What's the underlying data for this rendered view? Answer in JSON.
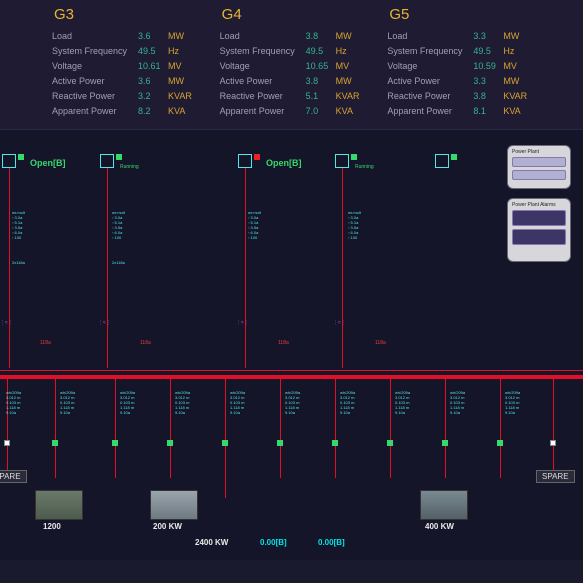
{
  "metrics_labels": [
    "Load",
    "System Frequency",
    "Voltage",
    "Active Power",
    "Reactive Power",
    "Apparent Power"
  ],
  "units": [
    "MW",
    "Hz",
    "MV",
    "MW",
    "KVAR",
    "KVA"
  ],
  "generators": [
    {
      "name": "G3",
      "values": [
        "3.6",
        "49.5",
        "10.61",
        "3.6",
        "3.2",
        "8.2"
      ]
    },
    {
      "name": "G4",
      "values": [
        "3.8",
        "49.5",
        "10.65",
        "3.8",
        "5.1",
        "7.0"
      ]
    },
    {
      "name": "G5",
      "values": [
        "3.3",
        "49.5",
        "10.59",
        "3.3",
        "3.8",
        "8.1"
      ]
    }
  ],
  "open_label": "Open[B]",
  "power_plant": "Power Plant",
  "power_plant_alarms": "Power Plant Alarms",
  "spare": "SPARE",
  "kw_labels": [
    "1200",
    "200 KW",
    "2400 KW",
    "400 KW"
  ],
  "readouts": [
    "0.00[B]",
    "0.00[B]"
  ]
}
